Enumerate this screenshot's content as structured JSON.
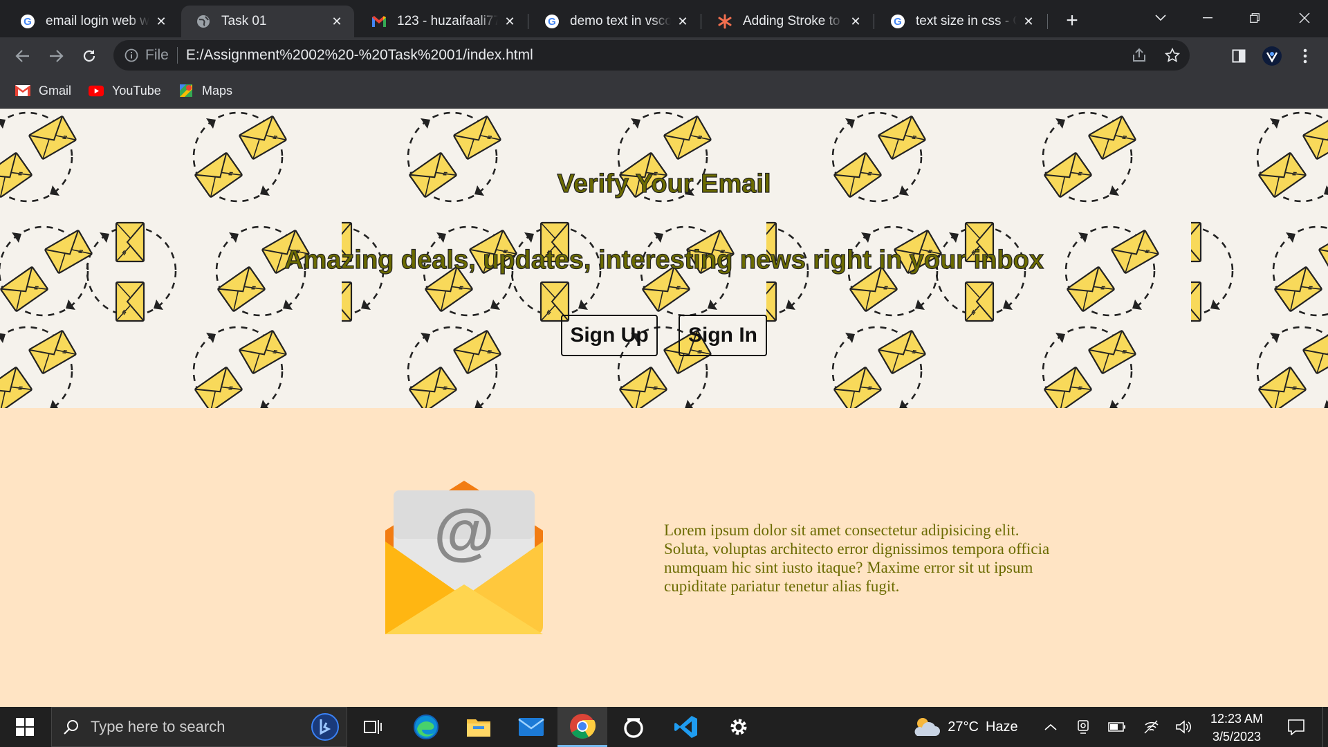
{
  "browser": {
    "tabs": [
      {
        "title": "email login web wo",
        "favicon": "google-icon",
        "active": false
      },
      {
        "title": "Task 01",
        "favicon": "globe-icon",
        "active": true
      },
      {
        "title": "123 - huzaifaali779",
        "favicon": "gmail-icon",
        "active": false
      },
      {
        "title": "demo text in vscod",
        "favicon": "google-icon",
        "active": false
      },
      {
        "title": "Adding Stroke to W",
        "favicon": "asterisk-icon",
        "active": false
      },
      {
        "title": "text size in css - Go",
        "favicon": "google-icon",
        "active": false
      }
    ],
    "address": {
      "scheme": "File",
      "url": "E:/Assignment%2002%20-%20Task%2001/index.html"
    },
    "bookmarks": [
      {
        "label": "Gmail",
        "icon": "gmail-icon"
      },
      {
        "label": "YouTube",
        "icon": "youtube-icon"
      },
      {
        "label": "Maps",
        "icon": "maps-icon"
      }
    ]
  },
  "page": {
    "hero": {
      "title": "Verify Your Email",
      "subtitle": "Amazing deals, updates, interesting news right in your inbox",
      "signup_label": "Sign Up",
      "signin_label": "Sign In"
    },
    "body_text": "Lorem ipsum dolor sit amet consectetur adipisicing elit. Soluta, voluptas architecto error dignissimos tempora officia numquam hic sint iusto itaque? Maxime error sit ut ipsum cupiditate pariatur tenetur alias fugit."
  },
  "taskbar": {
    "search_placeholder": "Type here to search",
    "weather": {
      "temp": "27°C",
      "condition": "Haze"
    },
    "clock": {
      "time": "12:23 AM",
      "date": "3/5/2023"
    }
  },
  "colors": {
    "hero_bg": "#f5f2ec",
    "section_bg": "#ffe4c4",
    "text_olive": "#6b6b00",
    "envelope_yellow": "#f8d95a"
  }
}
